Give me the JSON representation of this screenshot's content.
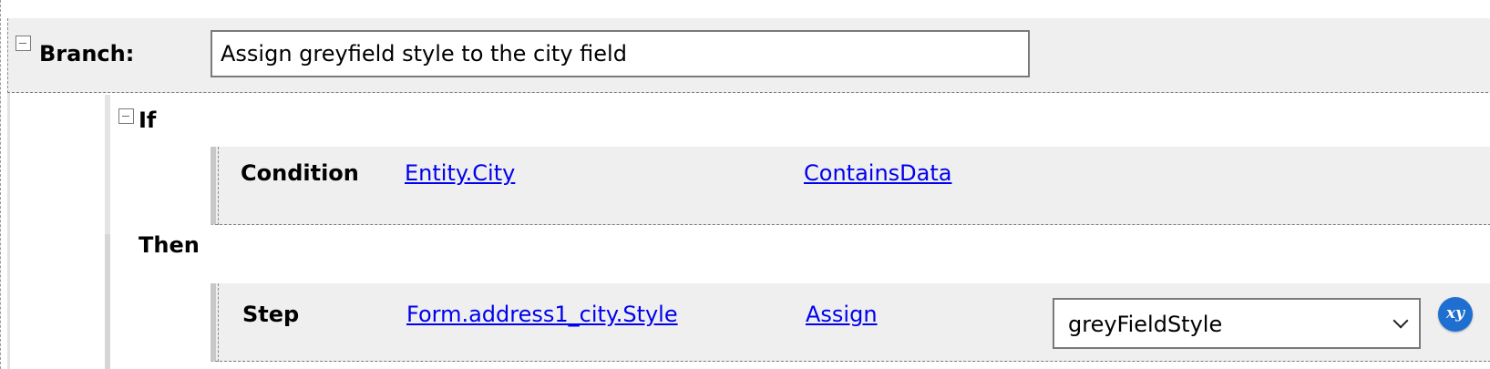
{
  "branch": {
    "label": "Branch:",
    "name_value": "Assign greyfield style to the city field"
  },
  "if_block": {
    "label": "If",
    "condition": {
      "label": "Condition",
      "field_link": "Entity.City",
      "operator_link": "ContainsData"
    }
  },
  "then_block": {
    "label": "Then",
    "step": {
      "label": "Step",
      "target_link": "Form.address1_city.Style",
      "action_link": "Assign",
      "value_selected": "greyFieldStyle",
      "expression_icon": "xy-expression-icon",
      "expression_icon_text": "xy"
    }
  },
  "colors": {
    "panel_bg": "#efefef",
    "link": "#0000ee",
    "expression_icon_bg": "#1f6fd1"
  }
}
